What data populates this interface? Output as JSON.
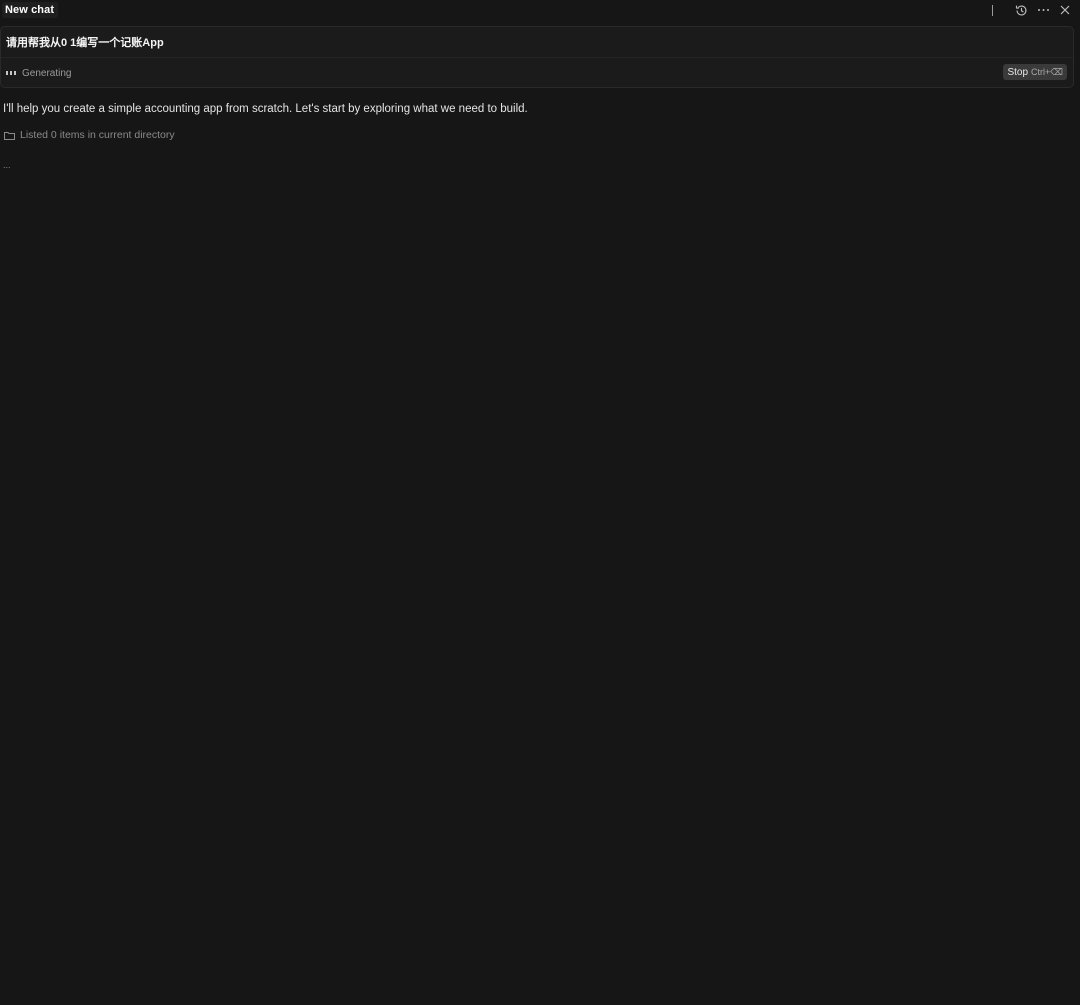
{
  "header": {
    "tab_title": "New chat",
    "icons": [
      "history-icon",
      "more-icon",
      "close-icon"
    ]
  },
  "prompt": {
    "text": "请用帮我从0 1编写一个记账App",
    "status": "Generating",
    "stop_label": "Stop",
    "stop_shortcut": "Ctrl+⌫"
  },
  "response": {
    "message": "I'll help you create a simple accounting app from scratch. Let's start by exploring what we need to build.",
    "tool_call": "Listed 0 items in current directory",
    "typing_indicator": "..."
  },
  "colors": {
    "background": "#161616",
    "card": "#1b1b1b",
    "stop_button": "#3a3a3a"
  }
}
